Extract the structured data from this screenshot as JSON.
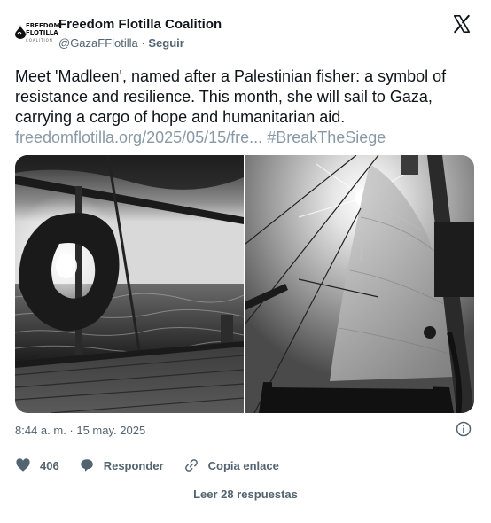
{
  "author": {
    "name": "Freedom Flotilla Coalition",
    "handle": "@GazaFFlotilla",
    "separator": "·",
    "follow_label": "Seguir",
    "logo_text": "FREEDOM\nFLOTILLA",
    "logo_subtext": "COALITION"
  },
  "tweet": {
    "text": "Meet 'Madleen', named after a Palestinian fisher: a symbol of resistance and resilience. This month, she will sail to Gaza, carrying a cargo of hope and humanitarian aid.",
    "link": "freedomflotilla.org/2025/05/15/fre...",
    "hashtag": "#BreakTheSiege"
  },
  "media": {
    "photos": [
      {
        "subject": "life-ring-on-boat-deck"
      },
      {
        "subject": "sailboat-mast-and-sail-with-sun"
      }
    ]
  },
  "meta": {
    "timestamp": "8:44 a. m. · 15 may. 2025"
  },
  "actions": {
    "likes_count": "406",
    "reply_label": "Responder",
    "copy_link_label": "Copia enlace"
  },
  "footer": {
    "read_replies_label": "Leer 28 respuestas"
  },
  "icons": {
    "platform": "x-logo-icon",
    "info": "info-icon",
    "like": "heart-icon",
    "reply": "speech-bubble-icon",
    "copy_link": "link-icon"
  },
  "colors": {
    "text": "#0f1419",
    "secondary": "#536471",
    "link": "#1d9bf0",
    "muted_link": "#8899a6"
  }
}
